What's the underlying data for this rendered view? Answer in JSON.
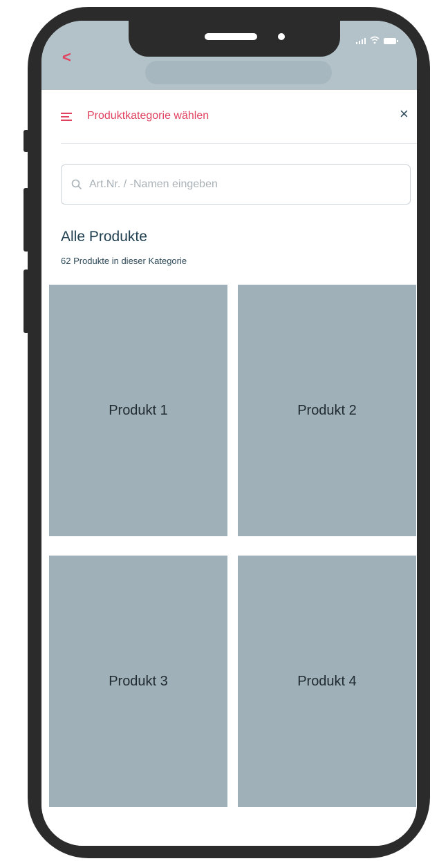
{
  "status_bar": {
    "icons": [
      "signal-icon",
      "wifi-icon",
      "battery-icon"
    ]
  },
  "app_header": {
    "back_icon": "chevron-left-icon",
    "back_glyph": "<"
  },
  "sheet": {
    "title": "Produktkategorie wählen",
    "menu_icon": "menu-icon",
    "close_glyph": "×"
  },
  "search": {
    "placeholder": "Art.Nr. / -Namen eingeben",
    "value": ""
  },
  "category": {
    "title": "Alle Produkte",
    "subtitle": "62 Produkte in dieser Kategorie"
  },
  "products": [
    {
      "label": "Produkt 1"
    },
    {
      "label": "Produkt 2"
    },
    {
      "label": "Produkt 3"
    },
    {
      "label": "Produkt 4"
    }
  ],
  "colors": {
    "accent": "#e0425f",
    "header_bg": "#b3c1c9",
    "tile_bg": "#a0b0b8",
    "text_dark": "#1f3f50",
    "frame": "#2b2b2b"
  }
}
